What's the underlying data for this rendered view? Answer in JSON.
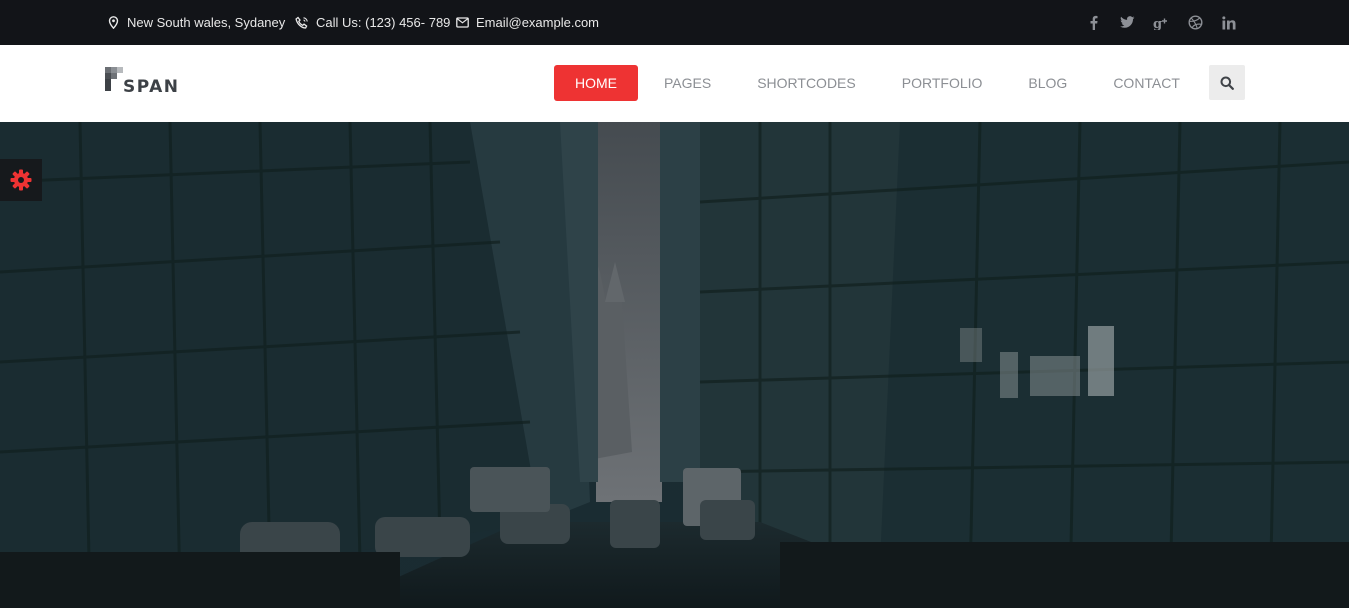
{
  "topbar": {
    "address": "New South wales, Sydaney",
    "phone": "Call Us: (123) 456- 789",
    "email": "Email@example.com",
    "social": [
      "facebook-icon",
      "twitter-icon",
      "google-plus-icon",
      "dribbble-icon",
      "linkedin-icon"
    ]
  },
  "brand": {
    "name": "SPAN"
  },
  "nav": {
    "items": [
      {
        "label": "HOME",
        "active": true
      },
      {
        "label": "PAGES",
        "active": false
      },
      {
        "label": "SHORTCODES",
        "active": false
      },
      {
        "label": "PORTFOLIO",
        "active": false
      },
      {
        "label": "BLOG",
        "active": false
      },
      {
        "label": "CONTACT",
        "active": false
      }
    ],
    "search_icon": "search-icon"
  },
  "hero": {
    "image": "city-street-background"
  },
  "settings_icon": "gear-icon",
  "colors": {
    "accent": "#ee3333",
    "topbar": "#121418",
    "nav_text": "#8c8f94"
  }
}
